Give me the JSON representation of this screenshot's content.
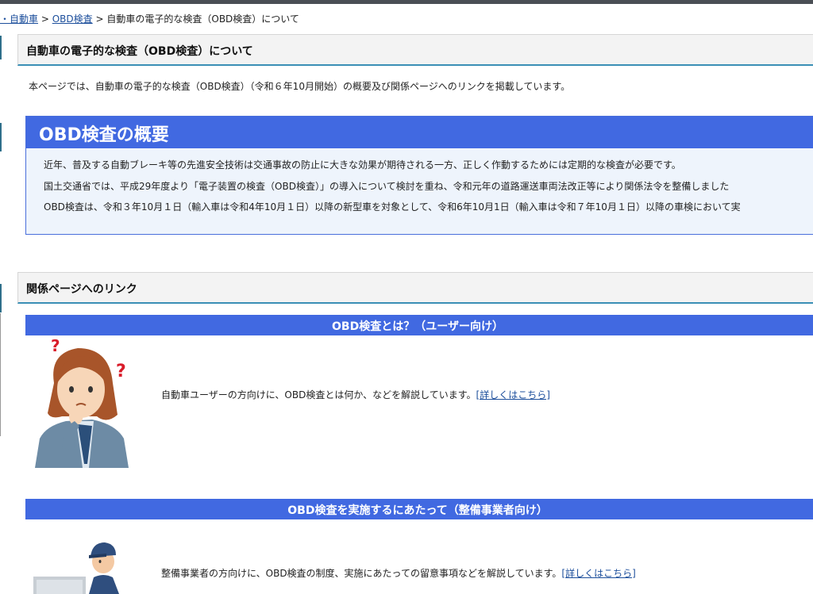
{
  "breadcrumb": {
    "item1": "・自動車",
    "sep1": ">",
    "item2": "OBD検査",
    "sep2": ">",
    "current": "自動車の電子的な検査（OBD検査）について"
  },
  "page": {
    "title": "自動車の電子的な検査（OBD検査）について",
    "lead": "本ページでは、自動車の電子的な検査（OBD検査）（令和６年10月開始）の概要及び関係ページへのリンクを掲載しています。"
  },
  "overview": {
    "title": "OBD検査の概要",
    "lines": [
      "近年、普及する自動ブレーキ等の先進安全技術は交通事故の防止に大きな効果が期待される一方、正しく作動するためには定期的な検査が必要です。",
      "国土交通省では、平成29年度より「電子装置の検査（OBD検査）」の導入について検討を重ね、令和元年の道路運送車両法改正等により関係法令を整備しました",
      "OBD検査は、令和３年10月１日（輸入車は令和4年10月１日）以降の新型車を対象として、令和6年10月1日（輸入車は令和７年10月１日）以降の車検において実"
    ]
  },
  "links": {
    "heading": "関係ページへのリンク",
    "items": [
      {
        "title": "OBD検査とは？（ユーザー向け）",
        "text": "自動車ユーザーの方向けに、OBD検査とは何か、などを解説しています。",
        "link": "[詳しくはこちら]",
        "icon": "confused-woman-illustration"
      },
      {
        "title": "OBD検査を実施するにあたって（整備事業者向け）",
        "text": "整備事業者の方向けに、OBD検査の制度、実施にあたっての留意事項などを解説しています。",
        "link": "[詳しくはこちら]",
        "icon": "mechanic-illustration"
      }
    ]
  },
  "colors": {
    "accent_blue": "#4169e1",
    "overview_bg": "#eef4fc",
    "rule_teal": "#3a8fb5"
  }
}
